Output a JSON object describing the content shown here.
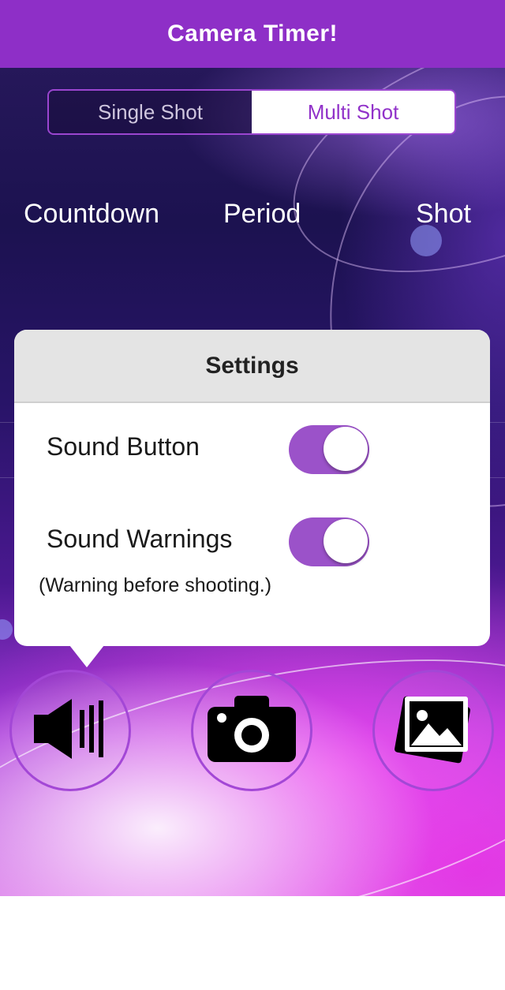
{
  "header": {
    "title": "Camera Timer!"
  },
  "segmented": {
    "options": [
      "Single Shot",
      "Multi Shot"
    ],
    "selected": "Multi Shot"
  },
  "columns": {
    "countdown": "Countdown",
    "period": "Period",
    "shot": "Shot"
  },
  "settings": {
    "title": "Settings",
    "sound_button": {
      "label": "Sound Button",
      "enabled": true
    },
    "sound_warnings": {
      "label": "Sound Warnings",
      "enabled": true,
      "note": "(Warning before shooting.)"
    }
  },
  "bottom_bar": {
    "buttons": [
      {
        "icon": "speaker-icon"
      },
      {
        "icon": "camera-icon"
      },
      {
        "icon": "gallery-icon"
      }
    ]
  },
  "colors": {
    "accent": "#8e2fc7",
    "toggle_on": "#9b52c9",
    "selected_segment_text": "#9132c9"
  }
}
